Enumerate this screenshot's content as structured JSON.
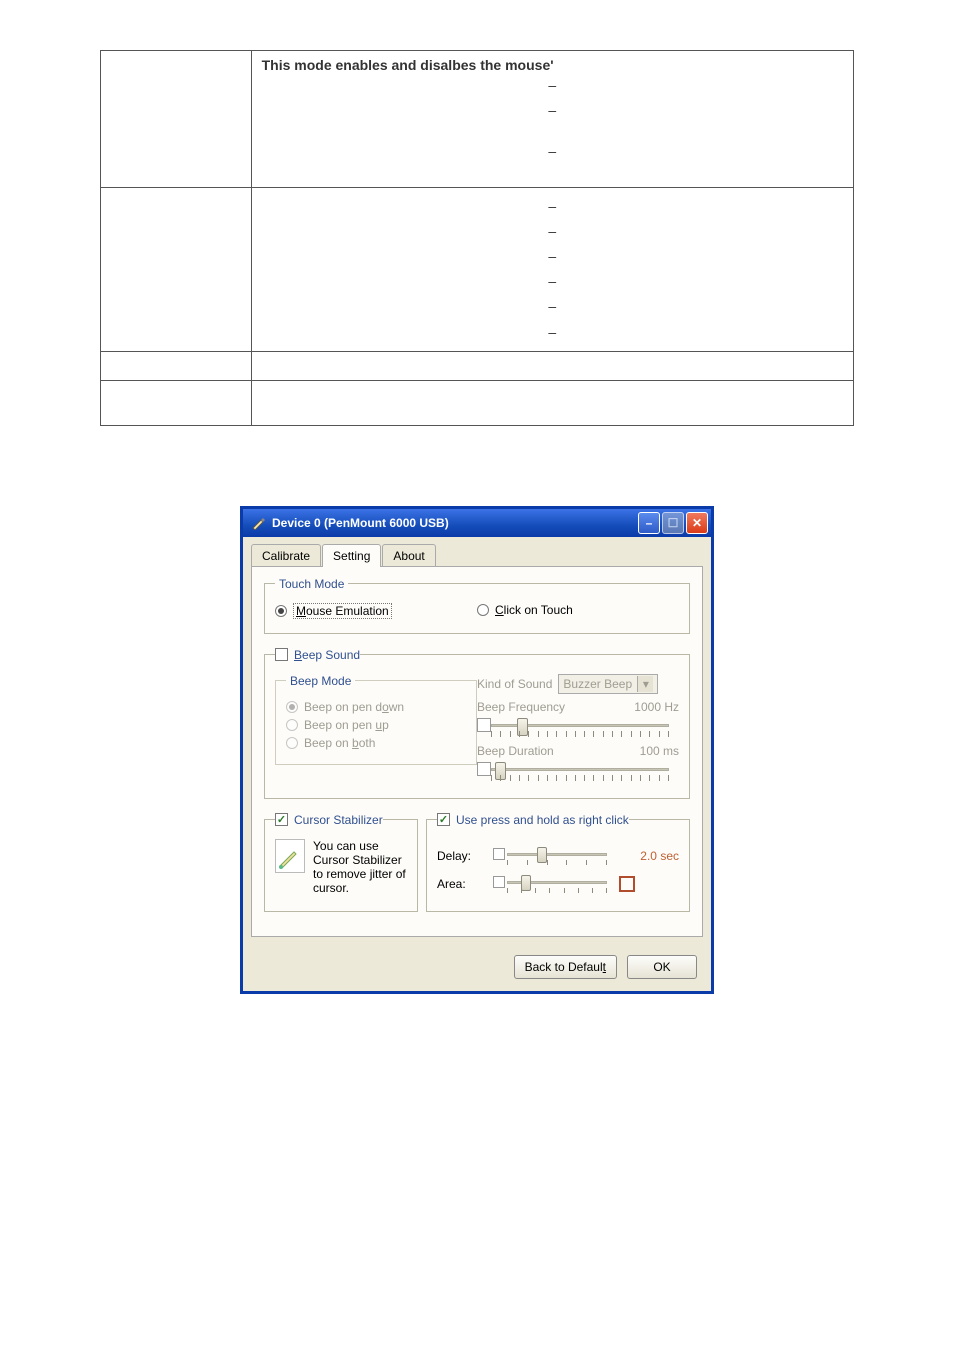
{
  "doc_table": {
    "row1_strong": "This mode enables and disalbes the mouse'",
    "dash": "–"
  },
  "dialog": {
    "title": "Device 0 (PenMount 6000 USB)",
    "tabs": {
      "calibrate": "Calibrate",
      "setting": "Setting",
      "about": "About"
    },
    "touch_mode": {
      "legend": "Touch Mode",
      "mouse_emulation": "Mouse Emulation",
      "click_on_touch": "Click on Touch"
    },
    "beep": {
      "sound": "Beep Sound",
      "mode_legend": "Beep Mode",
      "pen_down": "Beep on pen down",
      "pen_up": "Beep on pen up",
      "both": "Beep on both",
      "kind_label": "Kind of Sound",
      "kind_value": "Buzzer Beep",
      "freq_label": "Beep Frequency",
      "freq_value": "1000 Hz",
      "dur_label": "Beep Duration",
      "dur_value": "100  ms"
    },
    "stabilizer": {
      "check": "Cursor Stabilizer",
      "desc": "You can use Cursor Stabilizer to remove jitter of cursor."
    },
    "righthold": {
      "check": "Use press and hold as right click",
      "delay_label": "Delay:",
      "delay_value": "2.0 sec",
      "area_label": "Area:"
    },
    "buttons": {
      "back": "Back to Default",
      "ok": "OK"
    }
  }
}
